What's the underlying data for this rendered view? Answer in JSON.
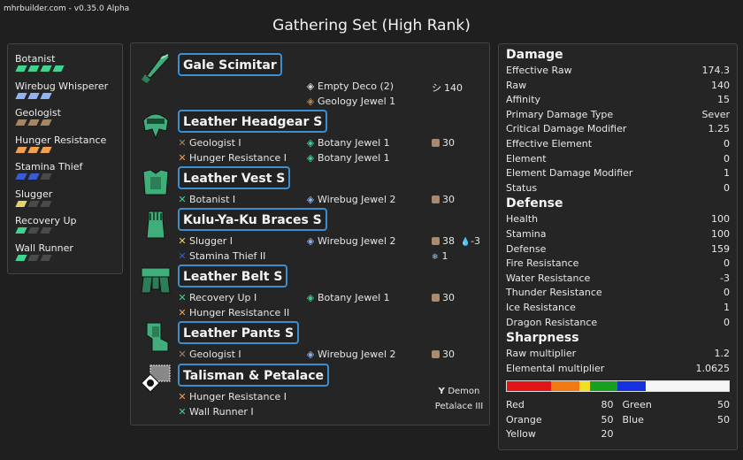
{
  "app": {
    "version_label": "mhrbuilder.com - v0.35.0 Alpha",
    "set_title": "Gathering Set (High Rank)"
  },
  "skills": [
    {
      "name": "Botanist",
      "color": "#3fd38f",
      "level": 4,
      "max": 4
    },
    {
      "name": "Wirebug Whisperer",
      "color": "#8fb3f5",
      "level": 3,
      "max": 3
    },
    {
      "name": "Geologist",
      "color": "#a8855a",
      "level": 3,
      "max": 3
    },
    {
      "name": "Hunger Resistance",
      "color": "#f0a050",
      "level": 3,
      "max": 3
    },
    {
      "name": "Stamina Thief",
      "color": "#3a5ad8",
      "level": 2,
      "max": 3
    },
    {
      "name": "Slugger",
      "color": "#e3d46a",
      "level": 1,
      "max": 3
    },
    {
      "name": "Recovery Up",
      "color": "#3fd38f",
      "level": 1,
      "max": 3
    },
    {
      "name": "Wall Runner",
      "color": "#3fd38f",
      "level": 1,
      "max": 3
    }
  ],
  "equipment": [
    {
      "name": "Gale Scimitar",
      "icon": "long-sword-icon",
      "skills": [],
      "jewels": [
        {
          "label": "Empty Deco (2)",
          "icon": "empty-deco-icon"
        },
        {
          "label": "Geology Jewel 1",
          "icon": "geology-jewel-icon"
        }
      ],
      "stat": "140",
      "stat_icon": "sharpness-icon"
    },
    {
      "name": "Leather Headgear S",
      "icon": "helmet-icon",
      "skills": [
        {
          "label": "Geologist I",
          "color": "#a8855a"
        },
        {
          "label": "Hunger Resistance I",
          "color": "#f0a050"
        }
      ],
      "jewels": [
        {
          "label": "Botany Jewel 1",
          "icon": "botany-jewel-icon"
        },
        {
          "label": "Botany Jewel 1",
          "icon": "botany-jewel-icon"
        }
      ],
      "stat": "30",
      "stat_icon": "defense-icon"
    },
    {
      "name": "Leather Vest S",
      "icon": "chest-icon",
      "skills": [
        {
          "label": "Botanist I",
          "color": "#3fd38f"
        }
      ],
      "jewels": [
        {
          "label": "Wirebug Jewel 2",
          "icon": "wirebug-jewel-icon"
        }
      ],
      "stat": "30",
      "stat_icon": "defense-icon"
    },
    {
      "name": "Kulu-Ya-Ku Braces S",
      "icon": "arms-icon",
      "skills": [
        {
          "label": "Slugger I",
          "color": "#e3d46a"
        },
        {
          "label": "Stamina Thief II",
          "color": "#3a5ad8"
        }
      ],
      "jewels": [
        {
          "label": "Wirebug Jewel 2",
          "icon": "wirebug-jewel-icon"
        }
      ],
      "stat": "38",
      "stat_icon": "defense-icon",
      "res1": "-3",
      "res1_icon": "water-icon",
      "res2": "1",
      "res2_icon": "ice-icon"
    },
    {
      "name": "Leather Belt S",
      "icon": "waist-icon",
      "skills": [
        {
          "label": "Recovery Up I",
          "color": "#3fd38f"
        },
        {
          "label": "Hunger Resistance II",
          "color": "#f0a050"
        }
      ],
      "jewels": [
        {
          "label": "Botany Jewel 1",
          "icon": "botany-jewel-icon"
        }
      ],
      "stat": "30",
      "stat_icon": "defense-icon"
    },
    {
      "name": "Leather Pants S",
      "icon": "legs-icon",
      "skills": [
        {
          "label": "Geologist I",
          "color": "#a8855a"
        }
      ],
      "jewels": [
        {
          "label": "Wirebug Jewel 2",
          "icon": "wirebug-jewel-icon"
        }
      ],
      "stat": "30",
      "stat_icon": "defense-icon"
    },
    {
      "name": "Talisman & Petalace",
      "icon": "talisman-icon",
      "skills": [
        {
          "label": "Hunger Resistance I",
          "color": "#f0a050"
        },
        {
          "label": "Wall Runner I",
          "color": "#3fd38f"
        }
      ],
      "jewels": [],
      "petalace_line1": "Demon",
      "petalace_line2": "Petalace III",
      "petalace_icon": "petalace-icon"
    }
  ],
  "stats": {
    "damage": {
      "title": "Damage",
      "rows": [
        [
          "Effective Raw",
          "174.3"
        ],
        [
          "Raw",
          "140"
        ],
        [
          "Affinity",
          "15"
        ],
        [
          "Primary Damage Type",
          "Sever"
        ],
        [
          "Critical Damage Modifier",
          "1.25"
        ],
        [
          "Effective Element",
          "0"
        ],
        [
          "Element",
          "0"
        ],
        [
          "Element Damage Modifier",
          "1"
        ],
        [
          "Status",
          "0"
        ]
      ]
    },
    "defense": {
      "title": "Defense",
      "rows": [
        [
          "Health",
          "100"
        ],
        [
          "Stamina",
          "100"
        ],
        [
          "Defense",
          "159"
        ],
        [
          "Fire Resistance",
          "0"
        ],
        [
          "Water Resistance",
          "-3"
        ],
        [
          "Thunder Resistance",
          "0"
        ],
        [
          "Ice Resistance",
          "1"
        ],
        [
          "Dragon Resistance",
          "0"
        ]
      ]
    },
    "sharpness": {
      "title": "Sharpness",
      "rows": [
        [
          "Raw multiplier",
          "1.2"
        ],
        [
          "Elemental multiplier",
          "1.0625"
        ]
      ],
      "segments": [
        {
          "name": "Red",
          "value": 80,
          "color": "#e01515"
        },
        {
          "name": "Orange",
          "value": 50,
          "color": "#f07a10"
        },
        {
          "name": "Yellow",
          "value": 20,
          "color": "#f2e020"
        },
        {
          "name": "Green",
          "value": 50,
          "color": "#15a020"
        },
        {
          "name": "Blue",
          "value": 50,
          "color": "#1530e0"
        }
      ],
      "max_total": 400,
      "legend": [
        [
          "Red",
          "80"
        ],
        [
          "Green",
          "50"
        ],
        [
          "Orange",
          "50"
        ],
        [
          "Blue",
          "50"
        ],
        [
          "Yellow",
          "20"
        ]
      ]
    }
  }
}
